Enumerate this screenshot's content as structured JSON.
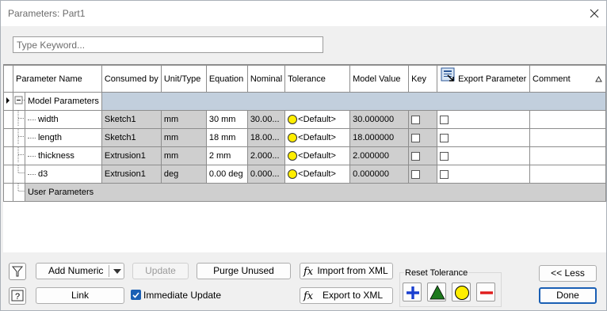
{
  "window": {
    "title": "Parameters: Part1"
  },
  "search": {
    "placeholder": "Type Keyword..."
  },
  "grid": {
    "columns": [
      "Parameter Name",
      "Consumed by",
      "Unit/Type",
      "Equation",
      "Nominal",
      "Tolerance",
      "Model Value",
      "Key",
      "Export Parameter",
      "Comment"
    ],
    "groups": {
      "model": "Model Parameters",
      "user": "User Parameters"
    },
    "rows": [
      {
        "name": "width",
        "consumed_by": "Sketch1",
        "unit": "mm",
        "equation": "30 mm",
        "nominal": "30.00...",
        "tolerance": "<Default>",
        "model_value": "30.000000",
        "key": false,
        "export": false,
        "comment": ""
      },
      {
        "name": "length",
        "consumed_by": "Sketch1",
        "unit": "mm",
        "equation": "18 mm",
        "nominal": "18.00...",
        "tolerance": "<Default>",
        "model_value": "18.000000",
        "key": false,
        "export": false,
        "comment": ""
      },
      {
        "name": "thickness",
        "consumed_by": "Extrusion1",
        "unit": "mm",
        "equation": "2 mm",
        "nominal": "2.000...",
        "tolerance": "<Default>",
        "model_value": "2.000000",
        "key": false,
        "export": false,
        "comment": ""
      },
      {
        "name": "d3",
        "consumed_by": "Extrusion1",
        "unit": "deg",
        "equation": "0.00 deg",
        "nominal": "0.000...",
        "tolerance": "<Default>",
        "model_value": "0.000000",
        "key": false,
        "export": false,
        "comment": ""
      }
    ]
  },
  "buttons": {
    "add_numeric": "Add Numeric",
    "update": "Update",
    "purge_unused": "Purge Unused",
    "import_xml": "Import from XML",
    "export_xml": "Export to XML",
    "link": "Link",
    "immediate_update": "Immediate Update",
    "less": "<< Less",
    "done": "Done"
  },
  "immediate_update_checked": true,
  "reset_tolerance": {
    "label": "Reset Tolerance"
  },
  "colors": {
    "band": "#c2cfdd",
    "readonly": "#cfcfcf",
    "tol_dot": "#ffee00",
    "plus": "#1a3fd0",
    "triangle": "#1e7a1e",
    "minus": "#e01c1c"
  }
}
